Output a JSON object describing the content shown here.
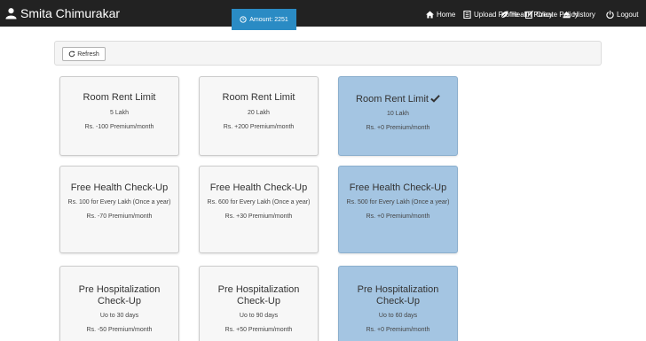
{
  "navbar": {
    "user_name": "Smita Chimurakar",
    "amount": "Amount: 2251",
    "items": [
      {
        "label": "Home",
        "icon": "home-icon"
      },
      {
        "label": "Upload Profile",
        "icon": "document-icon"
      },
      {
        "label": "Create Policy",
        "icon": "edit-icon"
      },
      {
        "label": "Health Policy",
        "icon": "leaf-icon"
      },
      {
        "label": "History",
        "icon": "eject-icon"
      },
      {
        "label": "Logout",
        "icon": "power-icon"
      }
    ]
  },
  "toolbar": {
    "refresh_label": "Refresh"
  },
  "options": [
    {
      "title": "Room Rent Limit",
      "cards": [
        {
          "sub": "5 Lakh",
          "price": "Rs. -100 Premium/month",
          "selected": false
        },
        {
          "sub": "20 Lakh",
          "price": "Rs. +200 Premium/month",
          "selected": false
        },
        {
          "sub": "10 Lakh",
          "price": "Rs. +0 Premium/month",
          "selected": true
        }
      ]
    },
    {
      "title": "Free Health Check-Up",
      "cards": [
        {
          "sub": "Rs. 100 for Every Lakh (Once a year)",
          "price": "Rs. -70 Premium/month",
          "selected": false
        },
        {
          "sub": "Rs. 600 for Every Lakh (Once a year)",
          "price": "Rs. +30 Premium/month",
          "selected": false
        },
        {
          "sub": "Rs. 500 for Every Lakh (Once a year)",
          "price": "Rs. +0 Premium/month",
          "selected": true
        }
      ]
    },
    {
      "title": "Pre Hospitalization Check-Up",
      "cards": [
        {
          "sub": "Uo to 30 days",
          "price": "Rs. -50 Premium/month",
          "selected": false
        },
        {
          "sub": "Uo to 90 days",
          "price": "Rs. +50 Premium/month",
          "selected": false
        },
        {
          "sub": "Uo to 60 days",
          "price": "Rs. +0 Premium/month",
          "selected": true
        }
      ]
    }
  ]
}
